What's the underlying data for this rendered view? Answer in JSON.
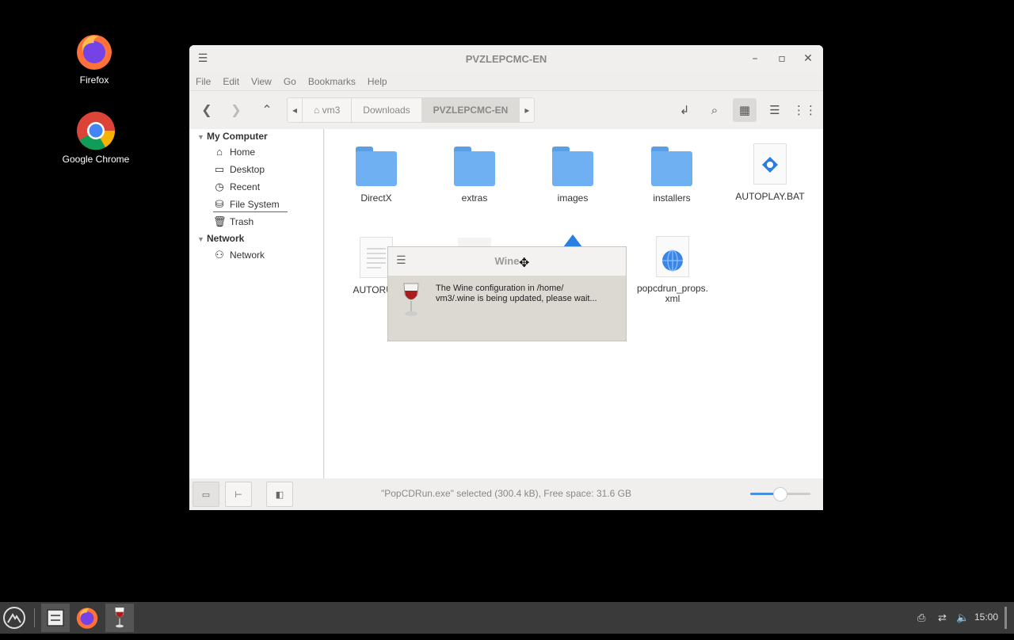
{
  "desktop": {
    "icons": [
      {
        "label": "Firefox"
      },
      {
        "label": "Google Chrome"
      }
    ]
  },
  "window": {
    "title": "PVZLEPCMC-EN",
    "menu": [
      "File",
      "Edit",
      "View",
      "Go",
      "Bookmarks",
      "Help"
    ],
    "breadcrumbs": [
      "vm3",
      "Downloads",
      "PVZLEPCMC-EN"
    ],
    "sidebar": {
      "my_computer": "My Computer",
      "items": [
        "Home",
        "Desktop",
        "Recent",
        "File System",
        "Trash"
      ],
      "network_head": "Network",
      "network_items": [
        "Network"
      ]
    },
    "files": [
      {
        "name": "DirectX",
        "kind": "folder"
      },
      {
        "name": "extras",
        "kind": "folder"
      },
      {
        "name": "images",
        "kind": "folder"
      },
      {
        "name": "installers",
        "kind": "folder"
      },
      {
        "name": "AUTOPLAY.BAT",
        "kind": "script"
      },
      {
        "name": "AUTORUN",
        "kind": "text"
      },
      {
        "name": "popcdrun_props.\nxml",
        "kind": "xml"
      }
    ],
    "status": "\"PopCDRun.exe\" selected (300.4 kB), Free space: 31.6 GB",
    "zoom_fraction": 0.5
  },
  "dialog": {
    "title": "Wine",
    "message": "The Wine configuration in /home/\nvm3/.wine is being updated, please wait..."
  },
  "taskbar": {
    "clock": "15:00"
  }
}
